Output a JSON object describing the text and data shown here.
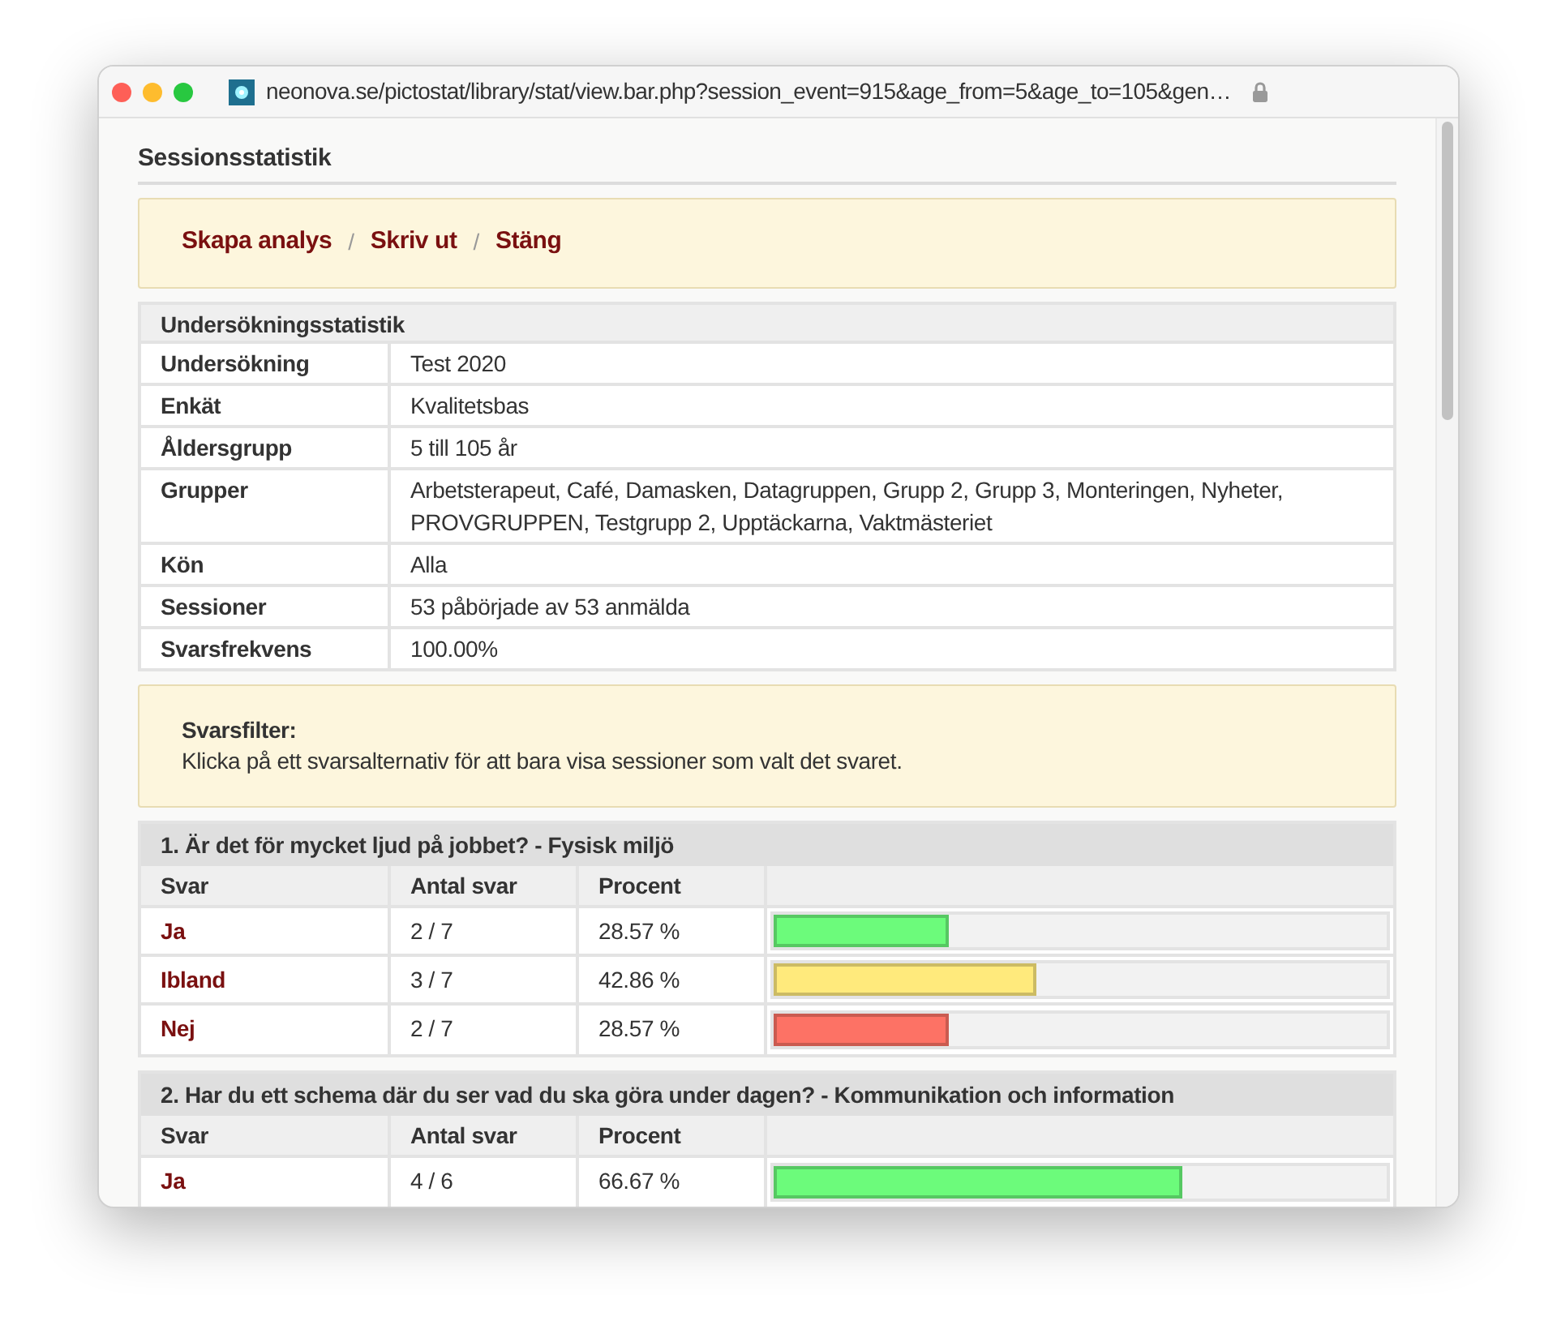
{
  "browser": {
    "url": "neonova.se/pictostat/library/stat/view.bar.php?session_event=915&age_from=5&age_to=105&gen…"
  },
  "page_title": "Sessionsstatistik",
  "actions": [
    "Skapa analys",
    "Skriv ut",
    "Stäng"
  ],
  "action_separator": "/",
  "survey_stats": {
    "title": "Undersökningsstatistik",
    "rows": [
      {
        "label": "Undersökning",
        "value": "Test 2020"
      },
      {
        "label": "Enkät",
        "value": "Kvalitetsbas"
      },
      {
        "label": "Åldersgrupp",
        "value": "5 till 105 år"
      },
      {
        "label": "Grupper",
        "value": "Arbetsterapeut, Café, Damasken, Datagruppen, Grupp 2, Grupp 3, Monteringen, Nyheter, PROVGRUPPEN, Testgrupp 2, Upptäckarna, Vaktmästeriet"
      },
      {
        "label": "Kön",
        "value": "Alla"
      },
      {
        "label": "Sessioner",
        "value": "53 påbörjade av 53 anmälda"
      },
      {
        "label": "Svarsfrekvens",
        "value": "100.00%"
      }
    ]
  },
  "filter_note": {
    "title": "Svarsfilter:",
    "text": "Klicka på ett svarsalternativ för att bara visa sessioner som valt det svaret."
  },
  "questions": [
    {
      "title": "1. Är det för mycket ljud på jobbet? - Fysisk miljö",
      "columns": [
        "Svar",
        "Antal svar",
        "Procent"
      ],
      "answers": [
        {
          "answer": "Ja",
          "count": "2 / 7",
          "percent": "28.57 %",
          "level": 0.2857,
          "color": "#6cfb7b"
        },
        {
          "answer": "Ibland",
          "count": "3 / 7",
          "percent": "42.86 %",
          "level": 0.4286,
          "color": "#ffea7c"
        },
        {
          "answer": "Nej",
          "count": "2 / 7",
          "percent": "28.57 %",
          "level": 0.2857,
          "color": "#fd7265"
        }
      ]
    },
    {
      "title": "2. Har du ett schema där du ser vad du ska göra under dagen? - Kommunikation och information",
      "columns": [
        "Svar",
        "Antal svar",
        "Procent"
      ],
      "answers": [
        {
          "answer": "Ja",
          "count": "4 / 6",
          "percent": "66.67 %",
          "level": 0.6667,
          "color": "#6cfb7b"
        }
      ]
    }
  ]
}
